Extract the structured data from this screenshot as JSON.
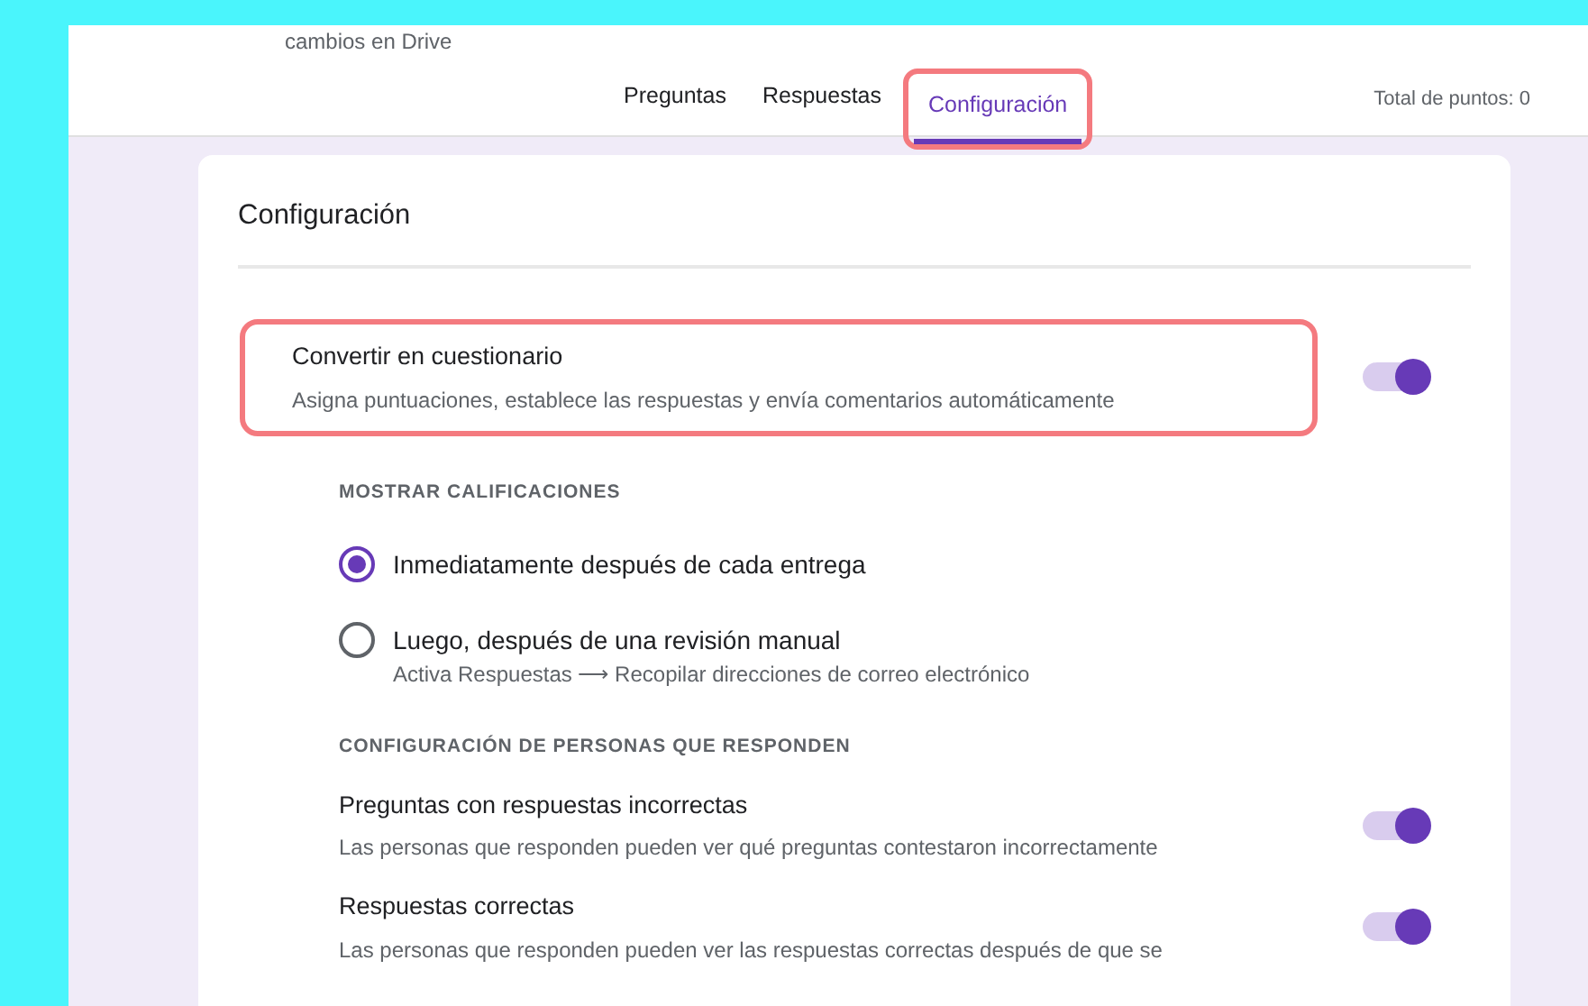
{
  "header": {
    "subtitle": "cambios en Drive"
  },
  "tabs": [
    {
      "label": "Preguntas",
      "selected": false,
      "highlighted": false
    },
    {
      "label": "Respuestas",
      "selected": false,
      "highlighted": false
    },
    {
      "label": "Configuración",
      "selected": true,
      "highlighted": true
    }
  ],
  "total_points": "Total de puntos: 0",
  "settings": {
    "title": "Configuración",
    "quiz": {
      "label": "Convertir en cuestionario",
      "description": "Asigna puntuaciones, establece las respuestas y envía comentarios automáticamente",
      "on": true,
      "highlighted": true
    },
    "sections": [
      {
        "heading": "MOSTRAR CALIFICACIONES",
        "items": [
          {
            "kind": "radio",
            "label": "Inmediatamente después de cada entrega",
            "selected": true
          },
          {
            "kind": "radio",
            "label": "Luego, después de una revisión manual",
            "hint": "Activa Respuestas ⟶ Recopilar direcciones de correo electrónico",
            "selected": false
          }
        ]
      },
      {
        "heading": "CONFIGURACIÓN DE PERSONAS QUE RESPONDEN",
        "items": [
          {
            "kind": "toggle",
            "label": "Preguntas con respuestas incorrectas",
            "description": "Las personas que responden pueden ver qué preguntas contestaron incorrectamente",
            "on": true
          },
          {
            "kind": "toggle",
            "label": "Respuestas correctas",
            "description": "Las personas que responden pueden ver las respuestas correctas después de que se",
            "on": true
          }
        ]
      }
    ]
  }
}
